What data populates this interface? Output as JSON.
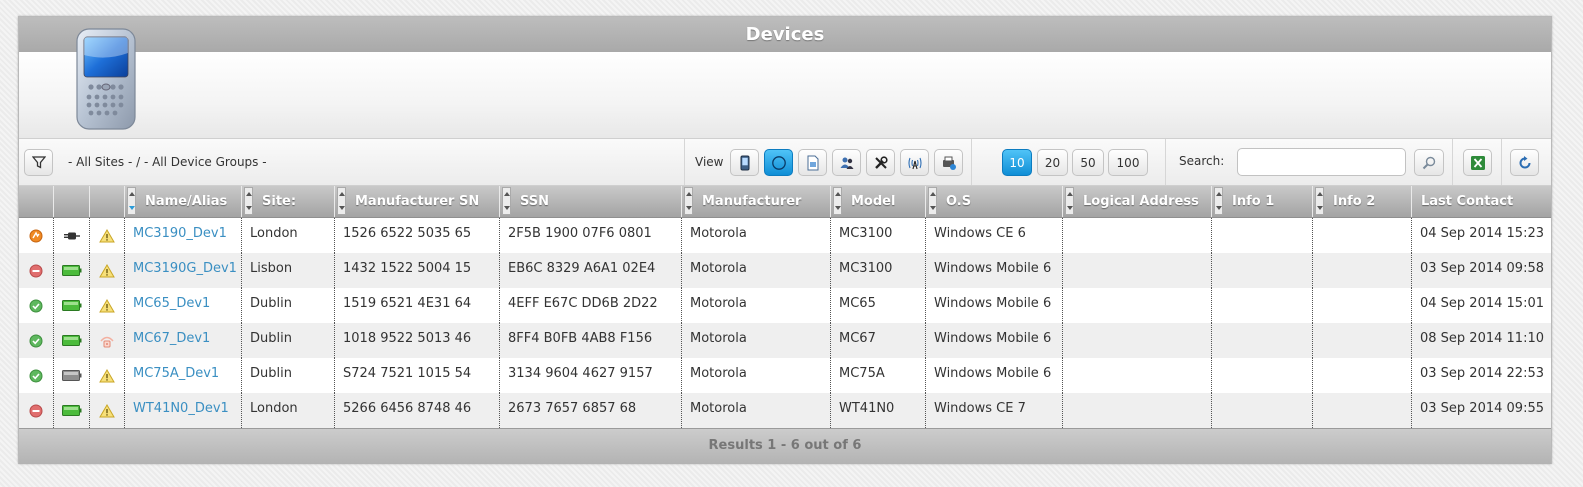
{
  "window": {
    "title": "Devices"
  },
  "toolbar": {
    "filter_icon": "filter-icon",
    "sites_text": "- All Sites - / - All Device Groups -",
    "view_label": "View",
    "view_buttons": [
      {
        "icon": "mobile-device-icon",
        "active": false
      },
      {
        "icon": "circle-icon",
        "active": true
      },
      {
        "icon": "document-icon",
        "active": false
      },
      {
        "icon": "users-icon",
        "active": false
      },
      {
        "icon": "tools-icon",
        "active": false
      },
      {
        "icon": "antenna-icon",
        "active": false
      },
      {
        "icon": "printer-device-icon",
        "active": false
      }
    ],
    "page_sizes": [
      "10",
      "20",
      "50",
      "100"
    ],
    "page_size_selected": "10",
    "search_label": "Search:",
    "search_value": "",
    "search_icon": "search-icon",
    "export_icon": "excel-export-icon",
    "refresh_icon": "refresh-icon"
  },
  "grid": {
    "columns": [
      "Name/Alias",
      "Site:",
      "Manufacturer SN",
      "SSN",
      "Manufacturer",
      "Model",
      "O.S",
      "Logical Address",
      "Info 1",
      "Info 2",
      "Last Contact"
    ],
    "sorted_column": "Name/Alias",
    "rows": [
      {
        "status": "update-status-icon",
        "power": "plug-icon",
        "alert": "warning-icon",
        "name": "MC3190_Dev1",
        "site": "London",
        "msn": "1526 6522 5035 65",
        "ssn": "2F5B 1900 07F6 0801",
        "manufacturer": "Motorola",
        "model": "MC3100",
        "os": "Windows CE 6",
        "logical": "",
        "info1": "",
        "info2": "",
        "last": "04 Sep 2014 15:23"
      },
      {
        "status": "offline-status-icon",
        "power": "battery-icon",
        "alert": "warning-icon",
        "name": "MC3190G_Dev1",
        "site": "Lisbon",
        "msn": "1432 1522 5004 15",
        "ssn": "EB6C 8329 A6A1 02E4",
        "manufacturer": "Motorola",
        "model": "MC3100",
        "os": "Windows Mobile 6",
        "logical": "",
        "info1": "",
        "info2": "",
        "last": "03 Sep 2014 09:58"
      },
      {
        "status": "online-status-icon",
        "power": "battery-icon",
        "alert": "warning-icon",
        "name": "MC65_Dev1",
        "site": "Dublin",
        "msn": "1519 6521 4E31 64",
        "ssn": "4EFF E67C DD6B 2D22",
        "manufacturer": "Motorola",
        "model": "MC65",
        "os": "Windows Mobile 6",
        "logical": "",
        "info1": "",
        "info2": "",
        "last": "04 Sep 2014 15:01"
      },
      {
        "status": "online-status-icon",
        "power": "battery-icon",
        "alert": "lock-alert-icon",
        "name": "MC67_Dev1",
        "site": "Dublin",
        "msn": "1018 9522 5013 46",
        "ssn": "8FF4 B0FB 4AB8 F156",
        "manufacturer": "Motorola",
        "model": "MC67",
        "os": "Windows Mobile 6",
        "logical": "",
        "info1": "",
        "info2": "",
        "last": "08 Sep 2014 11:10"
      },
      {
        "status": "online-status-icon",
        "power": "battery-grey-icon",
        "alert": "warning-icon",
        "name": "MC75A_Dev1",
        "site": "Dublin",
        "msn": "S724 7521 1015 54",
        "ssn": "3134 9604 4627 9157",
        "manufacturer": "Motorola",
        "model": "MC75A",
        "os": "Windows Mobile 6",
        "logical": "",
        "info1": "",
        "info2": "",
        "last": "03 Sep 2014 22:53"
      },
      {
        "status": "offline-status-icon",
        "power": "battery-icon",
        "alert": "warning-icon",
        "name": "WT41N0_Dev1",
        "site": "London",
        "msn": "5266 6456 8748 46",
        "ssn": "2673 7657 6857 68",
        "manufacturer": "Motorola",
        "model": "WT41N0",
        "os": "Windows CE 7",
        "logical": "",
        "info1": "",
        "info2": "",
        "last": "03 Sep 2014 09:55"
      }
    ]
  },
  "footer": {
    "results_text": "Results 1 - 6 out of 6"
  }
}
